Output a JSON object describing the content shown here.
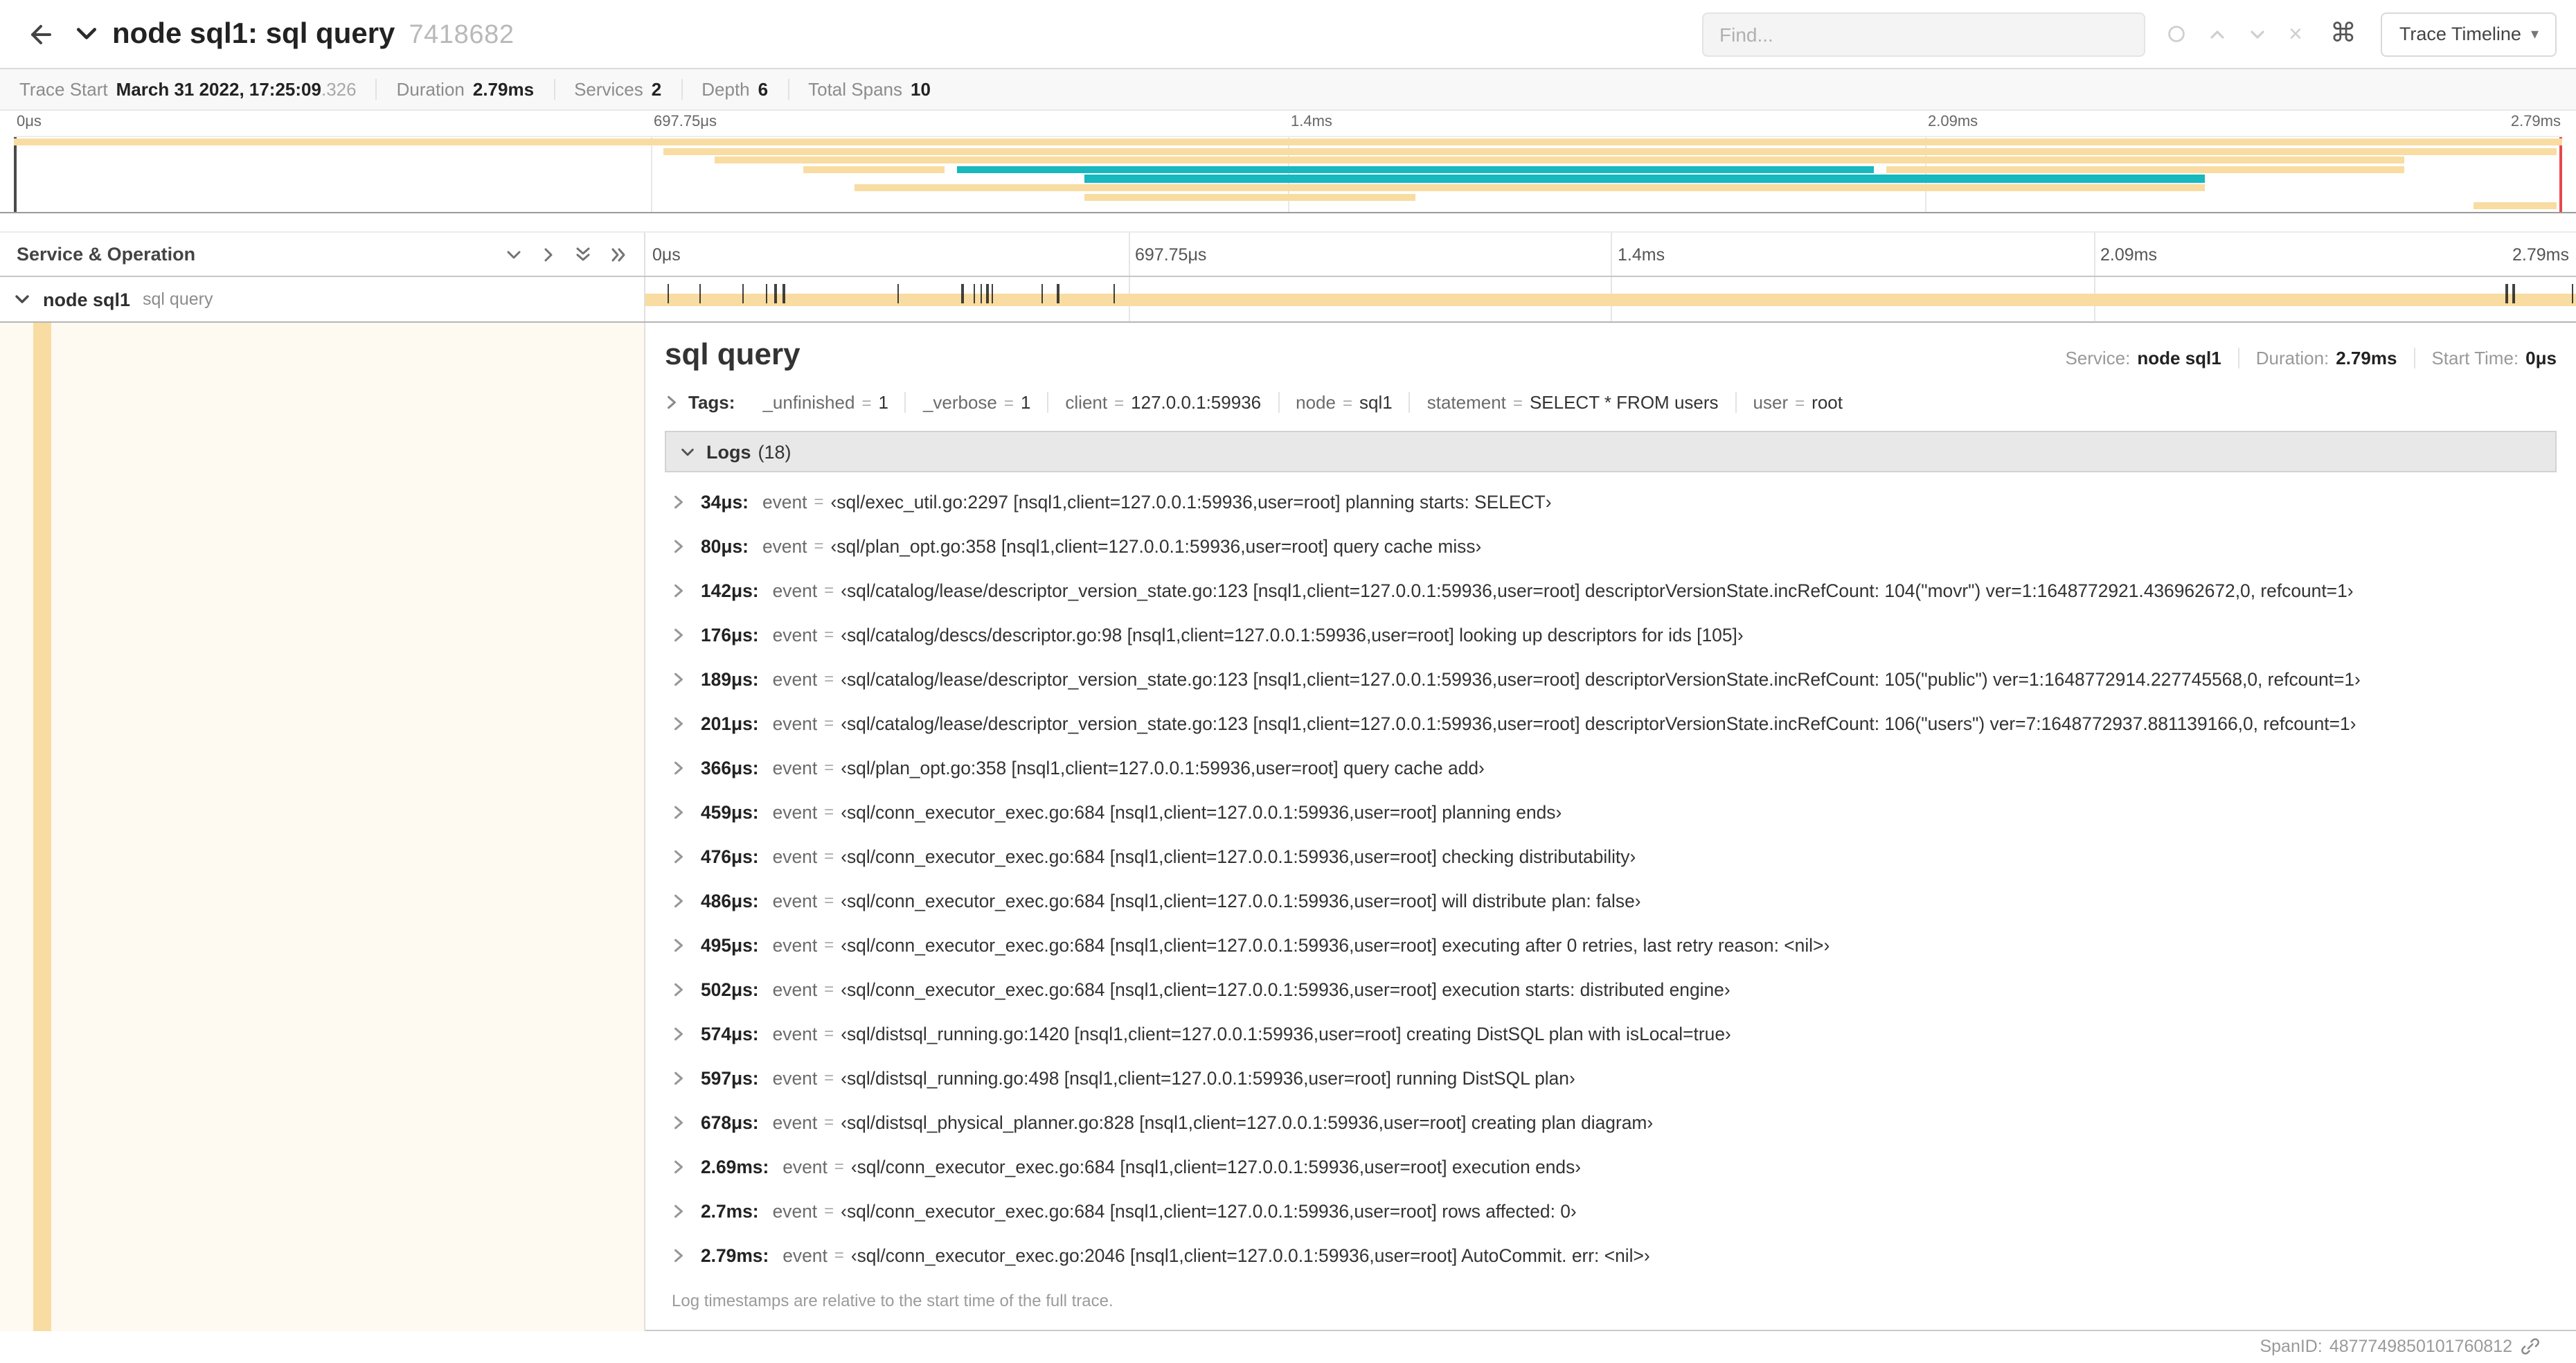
{
  "colors": {
    "tan": "#F8DCA1",
    "teal": "#17B8BE",
    "scrub_left": "#4a4a4a",
    "scrub_right": "#e5484d"
  },
  "header": {
    "title": "node sql1: sql query",
    "trace_id": "7418682",
    "find_placeholder": "Find...",
    "view_button": "Trace Timeline",
    "cmd_icon": "⌘"
  },
  "trace_stats": {
    "items": [
      {
        "label": "Trace Start",
        "value": "March 31 2022, 17:25:09",
        "suffix": ".326"
      },
      {
        "label": "Duration",
        "value": "2.79ms"
      },
      {
        "label": "Services",
        "value": "2"
      },
      {
        "label": "Depth",
        "value": "6"
      },
      {
        "label": "Total Spans",
        "value": "10"
      }
    ]
  },
  "minimap": {
    "ticks": [
      "0μs",
      "697.75μs",
      "1.4ms",
      "2.09ms",
      "2.79ms"
    ],
    "tick_pcts": [
      0,
      25,
      50,
      75,
      100
    ],
    "bars": [
      {
        "row": 0,
        "l": 0,
        "w": 100,
        "c": "tan"
      },
      {
        "row": 1,
        "l": 25.5,
        "w": 74.3,
        "c": "tan"
      },
      {
        "row": 2,
        "l": 27.5,
        "w": 66.3,
        "c": "tan"
      },
      {
        "row": 3,
        "l": 31,
        "w": 5.5,
        "c": "tan"
      },
      {
        "row": 3,
        "l": 37,
        "w": 36,
        "c": "teal"
      },
      {
        "row": 3,
        "l": 73.5,
        "w": 20.3,
        "c": "tan"
      },
      {
        "row": 4,
        "l": 42,
        "w": 44,
        "c": "teal"
      },
      {
        "row": 5,
        "l": 33,
        "w": 53,
        "c": "tan"
      },
      {
        "row": 6,
        "l": 42,
        "w": 13,
        "c": "tan"
      },
      {
        "row": 7,
        "l": 96.5,
        "w": 3.3,
        "c": "tan"
      }
    ]
  },
  "timeline": {
    "left_header": "Service & Operation",
    "ticks": [
      "0μs",
      "697.75μs",
      "1.4ms",
      "2.09ms",
      "2.79ms"
    ],
    "tick_pcts": [
      0,
      25,
      50,
      75,
      100
    ],
    "span": {
      "service": "node sql1",
      "operation": "sql query",
      "total_us": 2790,
      "log_times_us": [
        34,
        80,
        142,
        176,
        189,
        201,
        366,
        459,
        476,
        486,
        495,
        502,
        574,
        597,
        678,
        2690,
        2700,
        2790
      ]
    }
  },
  "detail": {
    "title": "sql query",
    "meta": [
      {
        "label": "Service:",
        "value": "node sql1"
      },
      {
        "label": "Duration:",
        "value": "2.79ms"
      },
      {
        "label": "Start Time:",
        "value": "0μs"
      }
    ],
    "tags_label": "Tags:",
    "tags": [
      {
        "key": "_unfinished",
        "value": "1"
      },
      {
        "key": "_verbose",
        "value": "1"
      },
      {
        "key": "client",
        "value": "127.0.0.1:59936"
      },
      {
        "key": "node",
        "value": "sql1"
      },
      {
        "key": "statement",
        "value": "SELECT * FROM users"
      },
      {
        "key": "user",
        "value": "root"
      }
    ],
    "logs_label": "Logs",
    "logs_count": "(18)",
    "logs": [
      {
        "time": "34μs:",
        "key": "event",
        "value": "‹sql/exec_util.go:2297 [nsql1,client=127.0.0.1:59936,user=root] planning starts: SELECT›"
      },
      {
        "time": "80μs:",
        "key": "event",
        "value": "‹sql/plan_opt.go:358 [nsql1,client=127.0.0.1:59936,user=root] query cache miss›"
      },
      {
        "time": "142μs:",
        "key": "event",
        "value": "‹sql/catalog/lease/descriptor_version_state.go:123 [nsql1,client=127.0.0.1:59936,user=root] descriptorVersionState.incRefCount: 104(\"movr\") ver=1:1648772921.436962672,0, refcount=1›"
      },
      {
        "time": "176μs:",
        "key": "event",
        "value": "‹sql/catalog/descs/descriptor.go:98 [nsql1,client=127.0.0.1:59936,user=root] looking up descriptors for ids [105]›"
      },
      {
        "time": "189μs:",
        "key": "event",
        "value": "‹sql/catalog/lease/descriptor_version_state.go:123 [nsql1,client=127.0.0.1:59936,user=root] descriptorVersionState.incRefCount: 105(\"public\") ver=1:1648772914.227745568,0, refcount=1›"
      },
      {
        "time": "201μs:",
        "key": "event",
        "value": "‹sql/catalog/lease/descriptor_version_state.go:123 [nsql1,client=127.0.0.1:59936,user=root] descriptorVersionState.incRefCount: 106(\"users\") ver=7:1648772937.881139166,0, refcount=1›"
      },
      {
        "time": "366μs:",
        "key": "event",
        "value": "‹sql/plan_opt.go:358 [nsql1,client=127.0.0.1:59936,user=root] query cache add›"
      },
      {
        "time": "459μs:",
        "key": "event",
        "value": "‹sql/conn_executor_exec.go:684 [nsql1,client=127.0.0.1:59936,user=root] planning ends›"
      },
      {
        "time": "476μs:",
        "key": "event",
        "value": "‹sql/conn_executor_exec.go:684 [nsql1,client=127.0.0.1:59936,user=root] checking distributability›"
      },
      {
        "time": "486μs:",
        "key": "event",
        "value": "‹sql/conn_executor_exec.go:684 [nsql1,client=127.0.0.1:59936,user=root] will distribute plan: false›"
      },
      {
        "time": "495μs:",
        "key": "event",
        "value": "‹sql/conn_executor_exec.go:684 [nsql1,client=127.0.0.1:59936,user=root] executing after 0 retries, last retry reason: <nil>›"
      },
      {
        "time": "502μs:",
        "key": "event",
        "value": "‹sql/conn_executor_exec.go:684 [nsql1,client=127.0.0.1:59936,user=root] execution starts: distributed engine›"
      },
      {
        "time": "574μs:",
        "key": "event",
        "value": "‹sql/distsql_running.go:1420 [nsql1,client=127.0.0.1:59936,user=root] creating DistSQL plan with isLocal=true›"
      },
      {
        "time": "597μs:",
        "key": "event",
        "value": "‹sql/distsql_running.go:498 [nsql1,client=127.0.0.1:59936,user=root] running DistSQL plan›"
      },
      {
        "time": "678μs:",
        "key": "event",
        "value": "‹sql/distsql_physical_planner.go:828 [nsql1,client=127.0.0.1:59936,user=root] creating plan diagram›"
      },
      {
        "time": "2.69ms:",
        "key": "event",
        "value": "‹sql/conn_executor_exec.go:684 [nsql1,client=127.0.0.1:59936,user=root] execution ends›"
      },
      {
        "time": "2.7ms:",
        "key": "event",
        "value": "‹sql/conn_executor_exec.go:684 [nsql1,client=127.0.0.1:59936,user=root] rows affected: 0›"
      },
      {
        "time": "2.79ms:",
        "key": "event",
        "value": "‹sql/conn_executor_exec.go:2046 [nsql1,client=127.0.0.1:59936,user=root] AutoCommit. err: <nil>›"
      }
    ],
    "footnote": "Log timestamps are relative to the start time of the full trace.",
    "span_id_label": "SpanID:",
    "span_id": "4877749850101760812"
  }
}
